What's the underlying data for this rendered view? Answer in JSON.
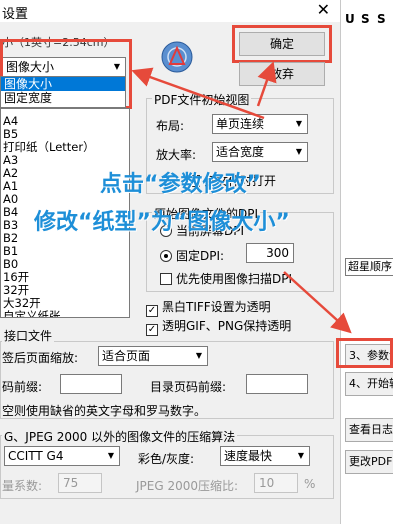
{
  "window": {
    "title": "设置",
    "close": "✕"
  },
  "unit_label": "小（1英寸=2.54cm）",
  "paper_select": {
    "value": "图像大小",
    "options": [
      "图像大小",
      "固定宽度"
    ]
  },
  "paper_list": [
    "A4",
    "B5",
    "打印纸（Letter）",
    "A3",
    "A2",
    "A1",
    "A0",
    "B4",
    "B3",
    "B2",
    "B1",
    "B0",
    "16开",
    "32开",
    "大32开",
    "自定义纸张"
  ],
  "buttons": {
    "ok": "确定",
    "cancel": "放弃"
  },
  "pdf_view": {
    "title": "PDF文件初始视图",
    "layout_label": "布局:",
    "layout_value": "单页连续",
    "zoom_label": "放大率:",
    "zoom_value": "适合宽度",
    "extra_text": "多文件时打开"
  },
  "dpi": {
    "title": "原始图像文件的DPI",
    "current_screen": "当前屏幕DPI",
    "fixed_label": "固定DPI:",
    "fixed_value": "300",
    "prefer_scan": "优先使用图像扫描DPI"
  },
  "checks": {
    "tiff": "黑白TIFF设置为透明",
    "gif": "透明GIF、PNG保持透明"
  },
  "interface": {
    "title": "接口文件",
    "scale_label": "签后页面缩放:",
    "scale_value": "适合页面",
    "prefix_label": "码前缀:",
    "toc_prefix_label": "目录页码前缀:",
    "note": "空则使用缺省的英文字母和罗马数字。"
  },
  "compression": {
    "title": "G、JPEG 2000 以外的图像文件的压缩算法",
    "mono_value": "CCITT G4",
    "color_label": "彩色/灰度:",
    "color_value": "速度最快",
    "quality_label": "量系数:",
    "quality_value": "75",
    "jpeg2000_label": "JPEG 2000压缩比:",
    "jpeg2000_value": "10",
    "percent": "%"
  },
  "right_panel": {
    "toolbar": [
      "U",
      "S",
      "S"
    ],
    "dropdown": "超星顺序",
    "step3": "3、参数设置",
    "step4": "4、开始转换",
    "log": "查看日志",
    "change_pdf": "更改PDF"
  },
  "annotations": {
    "line1": "点击“参数修改”",
    "line2": "修改“纸型”为“图像大小”"
  },
  "colors": {
    "annotation_blue": "#1e8fd8",
    "callout_red": "#e64a3b",
    "selection_blue": "#0078d7"
  }
}
